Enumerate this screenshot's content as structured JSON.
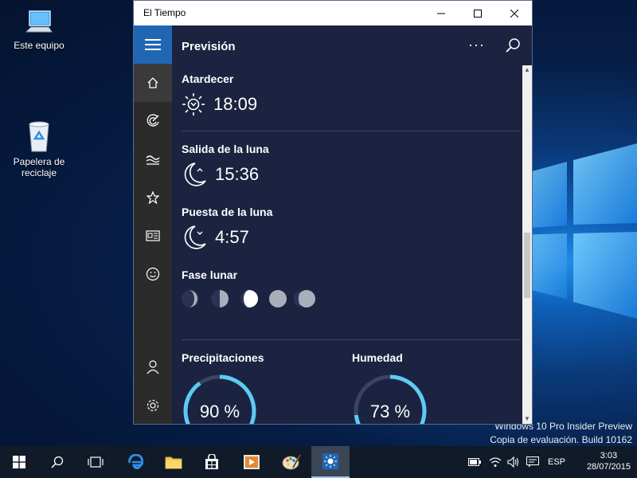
{
  "desktop": {
    "icons": [
      {
        "label": "Este equipo",
        "icon": "computer-icon"
      },
      {
        "label": "Papelera de reciclaje",
        "icon": "recycle-bin-icon"
      }
    ],
    "watermark_line1": "Windows 10 Pro Insider Preview",
    "watermark_line2": "Copia de evaluación. Build 10162"
  },
  "window": {
    "title": "El Tiempo",
    "header_title": "Previsión",
    "more_label": "···",
    "sunset": {
      "label": "Atardecer",
      "time": "18:09"
    },
    "moonrise": {
      "label": "Salida de la luna",
      "time": "15:36"
    },
    "moonset": {
      "label": "Puesta de la luna",
      "time": "4:57"
    },
    "moon_phase": {
      "label": "Fase lunar",
      "phases": [
        "waning-crescent",
        "last-quarter",
        "waxing-gibbous",
        "full",
        "waning-gibbous"
      ]
    },
    "precipitation": {
      "label": "Precipitaciones",
      "value": "90 %",
      "fraction": 0.9
    },
    "humidity": {
      "label": "Humedad",
      "value": "73 %",
      "fraction": 0.73
    }
  },
  "taskbar": {
    "language": "ESP",
    "time": "3:03",
    "date": "28/07/2015"
  },
  "colors": {
    "ring_accent": "#5ccbf5",
    "nav_accent": "#1f67b3"
  }
}
